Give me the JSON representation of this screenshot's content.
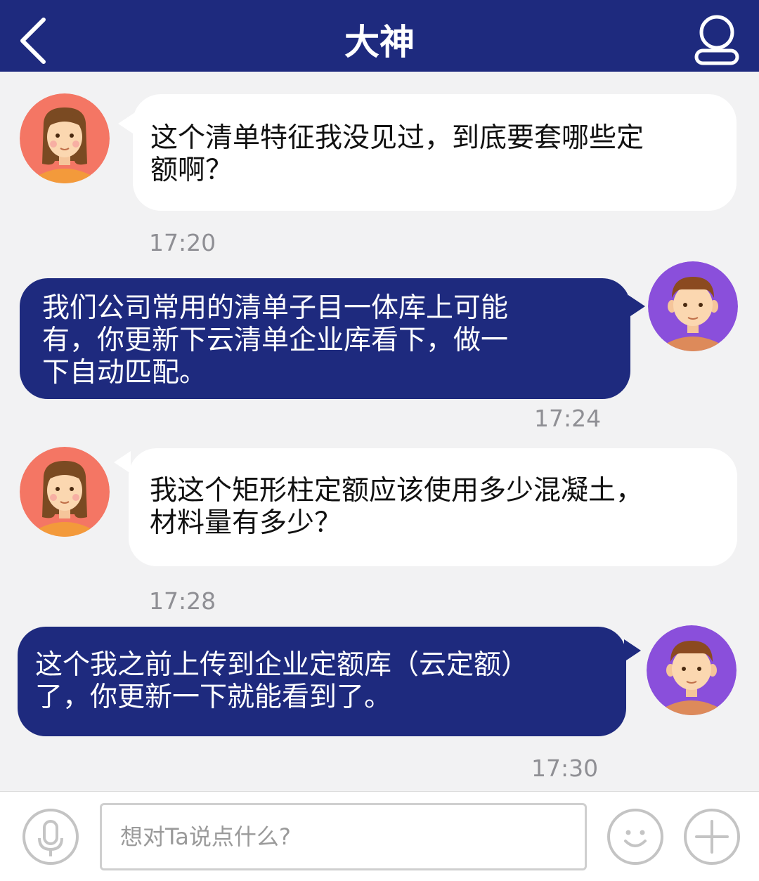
{
  "header": {
    "title": "大神"
  },
  "messages": [
    {
      "side": "in",
      "text": "这个清单特征我没见过，到底要套哪些定额啊？",
      "lines": [
        "这个清单特征我没见过，到底要套哪些定",
        "额啊？"
      ],
      "time": "17:20"
    },
    {
      "side": "out",
      "text": "我们公司常用的清单子目一体库上可能有，你更新下云清单企业库看下，做一下自动匹配。",
      "lines": [
        "我们公司常用的清单子目一体库上可能",
        "有，你更新下云清单企业库看下，做一",
        "下自动匹配。"
      ],
      "time": "17:24"
    },
    {
      "side": "in",
      "text": "我这个矩形柱定额应该使用多少混凝土，材料量有多少？",
      "lines": [
        "我这个矩形柱定额应该使用多少混凝土，",
        "材料量有多少？"
      ],
      "time": "17:28"
    },
    {
      "side": "out",
      "text": "这个我之前上传到企业定额库（云定额）了，你更新一下就能看到了。",
      "lines": [
        "这个我之前上传到企业定额库（云定额）",
        "了，你更新一下就能看到了。"
      ],
      "time": "17:30"
    }
  ],
  "composer": {
    "placeholder": "想对Ta说点什么?"
  },
  "icons": {
    "back": "chevron-left-icon",
    "profile": "user-icon",
    "voice": "microphone-icon",
    "emoji": "smiley-icon",
    "more": "plus-icon"
  },
  "colors": {
    "header": "#1e2a7e",
    "outgoing_bubble": "#1e2a7e",
    "incoming_bubble": "#ffffff",
    "background": "#f2f2f3",
    "female_avatar_bg": "#f47664",
    "male_avatar_bg": "#8a4fdb"
  }
}
